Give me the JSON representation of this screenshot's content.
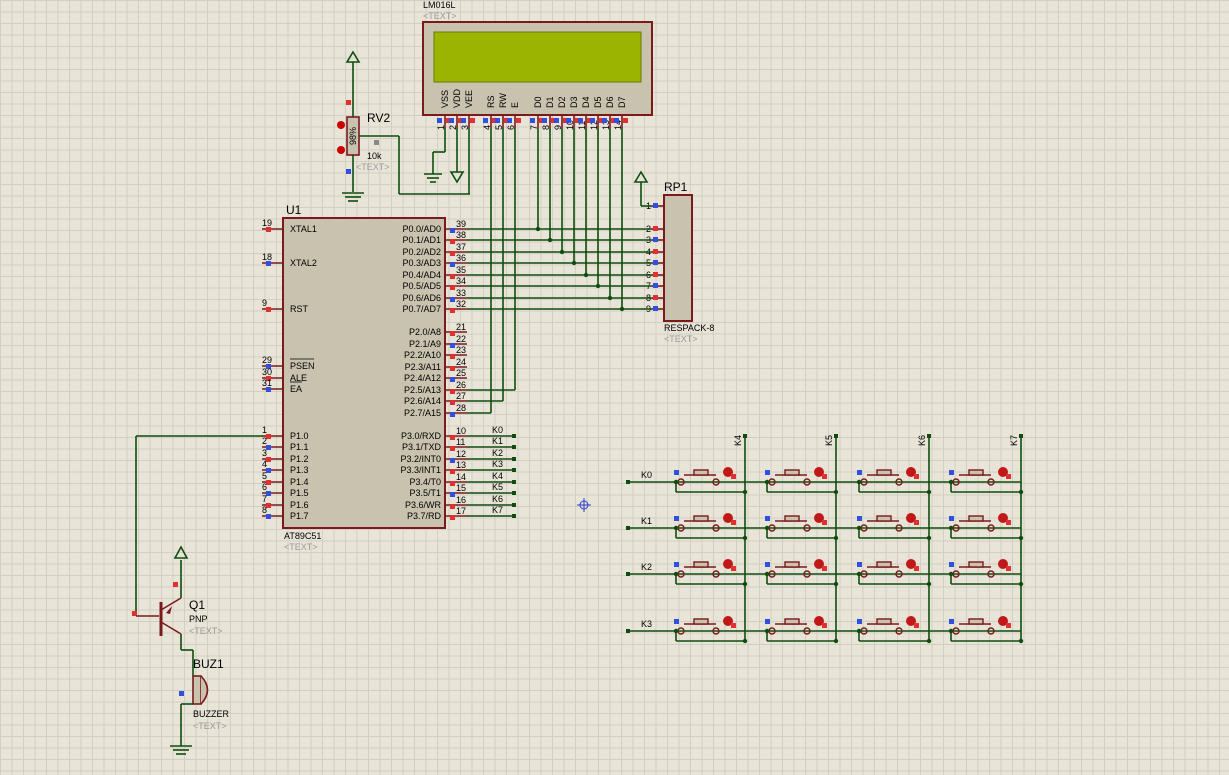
{
  "lcd": {
    "ref": "LM016L",
    "text_hint": "<TEXT>",
    "pins": [
      "VSS",
      "VDD",
      "VEE",
      "RS",
      "RW",
      "E",
      "D0",
      "D1",
      "D2",
      "D3",
      "D4",
      "D5",
      "D6",
      "D7"
    ],
    "pin_numbers": [
      "1",
      "2",
      "3",
      "4",
      "5",
      "6",
      "7",
      "8",
      "9",
      "10",
      "11",
      "12",
      "13",
      "14"
    ]
  },
  "pot": {
    "ref": "RV2",
    "value": "10k",
    "body_label": "98%",
    "text_hint": "<TEXT>"
  },
  "rpack": {
    "ref": "RP1",
    "part": "RESPACK-8",
    "text_hint": "<TEXT>",
    "pin_numbers": [
      "1",
      "2",
      "3",
      "4",
      "5",
      "6",
      "7",
      "8",
      "9"
    ]
  },
  "mcu": {
    "ref": "U1",
    "part": "AT89C51",
    "text_hint": "<TEXT>",
    "left_pins": [
      {
        "num": "19",
        "name": "XTAL1"
      },
      {
        "num": "18",
        "name": "XTAL2"
      },
      {
        "num": "9",
        "name": "RST"
      },
      {
        "num": "29",
        "name": "PSEN"
      },
      {
        "num": "30",
        "name": "ALE"
      },
      {
        "num": "31",
        "name": "EA"
      },
      {
        "num": "1",
        "name": "P1.0"
      },
      {
        "num": "2",
        "name": "P1.1"
      },
      {
        "num": "3",
        "name": "P1.2"
      },
      {
        "num": "4",
        "name": "P1.3"
      },
      {
        "num": "5",
        "name": "P1.4"
      },
      {
        "num": "6",
        "name": "P1.5"
      },
      {
        "num": "7",
        "name": "P1.6"
      },
      {
        "num": "8",
        "name": "P1.7"
      }
    ],
    "right_pins": [
      {
        "num": "39",
        "name": "P0.0/AD0"
      },
      {
        "num": "38",
        "name": "P0.1/AD1"
      },
      {
        "num": "37",
        "name": "P0.2/AD2"
      },
      {
        "num": "36",
        "name": "P0.3/AD3"
      },
      {
        "num": "35",
        "name": "P0.4/AD4"
      },
      {
        "num": "34",
        "name": "P0.5/AD5"
      },
      {
        "num": "33",
        "name": "P0.6/AD6"
      },
      {
        "num": "32",
        "name": "P0.7/AD7"
      },
      {
        "num": "21",
        "name": "P2.0/A8"
      },
      {
        "num": "22",
        "name": "P2.1/A9"
      },
      {
        "num": "23",
        "name": "P2.2/A10"
      },
      {
        "num": "24",
        "name": "P2.3/A11"
      },
      {
        "num": "25",
        "name": "P2.4/A12"
      },
      {
        "num": "26",
        "name": "P2.5/A13"
      },
      {
        "num": "27",
        "name": "P2.6/A14"
      },
      {
        "num": "28",
        "name": "P2.7/A15"
      },
      {
        "num": "10",
        "name": "P3.0/RXD"
      },
      {
        "num": "11",
        "name": "P3.1/TXD"
      },
      {
        "num": "12",
        "name": "P3.2/INT0"
      },
      {
        "num": "13",
        "name": "P3.3/INT1"
      },
      {
        "num": "14",
        "name": "P3.4/T0"
      },
      {
        "num": "15",
        "name": "P3.5/T1"
      },
      {
        "num": "16",
        "name": "P3.6/WR"
      },
      {
        "num": "17",
        "name": "P3.7/RD"
      }
    ]
  },
  "port3_nets": [
    "K0",
    "K1",
    "K2",
    "K3",
    "K4",
    "K5",
    "K6",
    "K7"
  ],
  "keypad": {
    "row_labels": [
      "K0",
      "K1",
      "K2",
      "K3"
    ],
    "col_labels": [
      "K4",
      "K5",
      "K6",
      "K7"
    ]
  },
  "transistor": {
    "ref": "Q1",
    "part": "PNP",
    "text_hint": "<TEXT>"
  },
  "buzzer": {
    "ref": "BUZ1",
    "part": "BUZZER",
    "text_hint": "<TEXT>"
  },
  "colors": {
    "grid": "#d2cec1",
    "background": "#e8e4d8",
    "body": "#c8c2ae",
    "outline": "#7a1a1a",
    "wire": "#0f4d0f",
    "lcd_screen": "#9bb400",
    "pin_red": "#e03030",
    "pin_blue": "#3050e0"
  }
}
